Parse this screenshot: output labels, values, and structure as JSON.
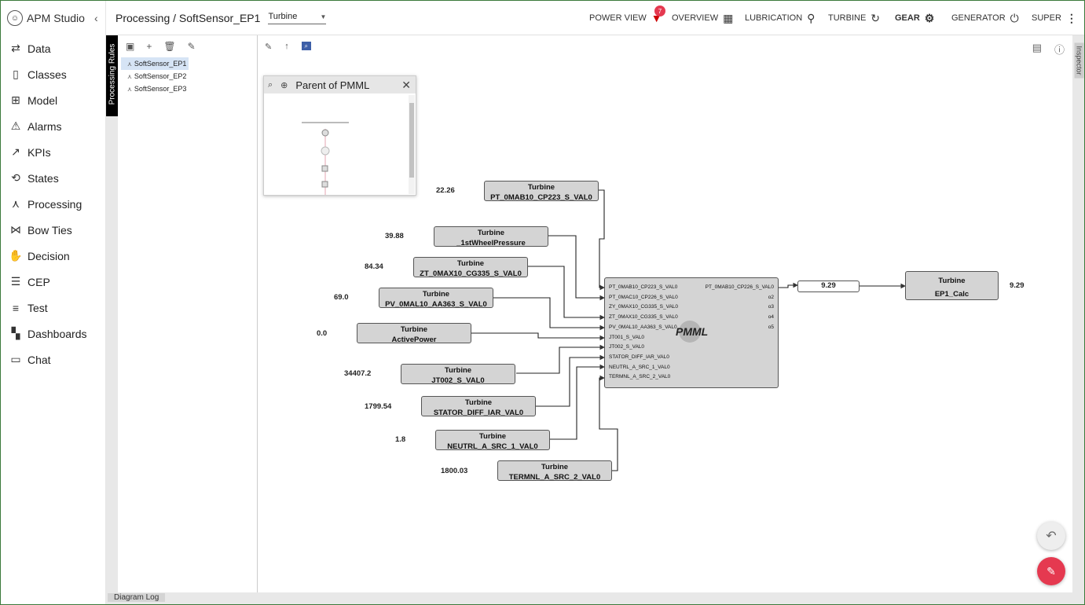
{
  "app": {
    "title": "APM Studio"
  },
  "sidebar": {
    "items": [
      {
        "label": "Data",
        "icon": "arrows-icon"
      },
      {
        "label": "Classes",
        "icon": "book-icon"
      },
      {
        "label": "Model",
        "icon": "hierarchy-icon"
      },
      {
        "label": "Alarms",
        "icon": "warning-icon"
      },
      {
        "label": "KPIs",
        "icon": "trend-icon"
      },
      {
        "label": "States",
        "icon": "loop-icon"
      },
      {
        "label": "Processing",
        "icon": "processing-icon"
      },
      {
        "label": "Bow Ties",
        "icon": "bowtie-icon"
      },
      {
        "label": "Decision",
        "icon": "decision-icon"
      },
      {
        "label": "CEP",
        "icon": "cep-icon"
      },
      {
        "label": "Test",
        "icon": "test-icon"
      },
      {
        "label": "Dashboards",
        "icon": "dashboard-icon"
      },
      {
        "label": "Chat",
        "icon": "chat-icon"
      }
    ]
  },
  "header": {
    "breadcrumb": "Processing / SoftSensor_EP1",
    "selector_value": "Turbine",
    "nav": [
      {
        "label": "POWER VIEW",
        "badge": "7"
      },
      {
        "label": "OVERVIEW"
      },
      {
        "label": "LUBRICATION"
      },
      {
        "label": "TURBINE"
      },
      {
        "label": "GEAR"
      },
      {
        "label": "GENERATOR"
      },
      {
        "label": "SUPER"
      }
    ]
  },
  "rules_panel": {
    "strip_label": "Processing Rules",
    "items": [
      "SoftSensor_EP1",
      "SoftSensor_EP2",
      "SoftSensor_EP3"
    ]
  },
  "inspector_label": "Inspector",
  "log_label": "Diagram Log",
  "overview": {
    "title": "Parent of PMML"
  },
  "diagram": {
    "inputs": [
      {
        "class": "Turbine",
        "name": "PT_0MAB10_CP223_S_VAL0",
        "value": "22.26"
      },
      {
        "class": "Turbine",
        "name": "_1stWheelPressure",
        "value": "39.88"
      },
      {
        "class": "Turbine",
        "name": "ZT_0MAX10_CG335_S_VAL0",
        "value": "84.34"
      },
      {
        "class": "Turbine",
        "name": "PV_0MAL10_AA363_S_VAL0",
        "value": "69.0"
      },
      {
        "class": "Turbine",
        "name": "ActivePower",
        "value": "0.0"
      },
      {
        "class": "Turbine",
        "name": "JT002_S_VAL0",
        "value": "34407.2"
      },
      {
        "class": "Turbine",
        "name": "STATOR_DIFF_IAR_VAL0",
        "value": "1799.54"
      },
      {
        "class": "Turbine",
        "name": "NEUTRL_A_SRC_1_VAL0",
        "value": "1.8"
      },
      {
        "class": "Turbine",
        "name": "TERMNL_A_SRC_2_VAL0",
        "value": "1800.03"
      }
    ],
    "pmml": {
      "title": "PMML",
      "in_pins": [
        "PT_0MAB10_CP223_S_VAL0",
        "PT_0MAC10_CP226_S_VAL0",
        "ZY_0MAX10_CG335_S_VAL0",
        "ZT_0MAX10_CG335_S_VAL0",
        "PV_0MAL10_AA363_S_VAL0",
        "JT001_S_VAL0",
        "JT002_S_VAL0",
        "STATOR_DIFF_IAR_VAL0",
        "NEUTRL_A_SRC_1_VAL0",
        "TERMNL_A_SRC_2_VAL0"
      ],
      "out_pins": [
        "PT_0MAB10_CP226_S_VAL0",
        "o2",
        "o3",
        "o4",
        "o5"
      ]
    },
    "intermediate_value": "9.29",
    "output": {
      "class": "Turbine",
      "name": "EP1_Calc",
      "value": "9.29"
    }
  }
}
